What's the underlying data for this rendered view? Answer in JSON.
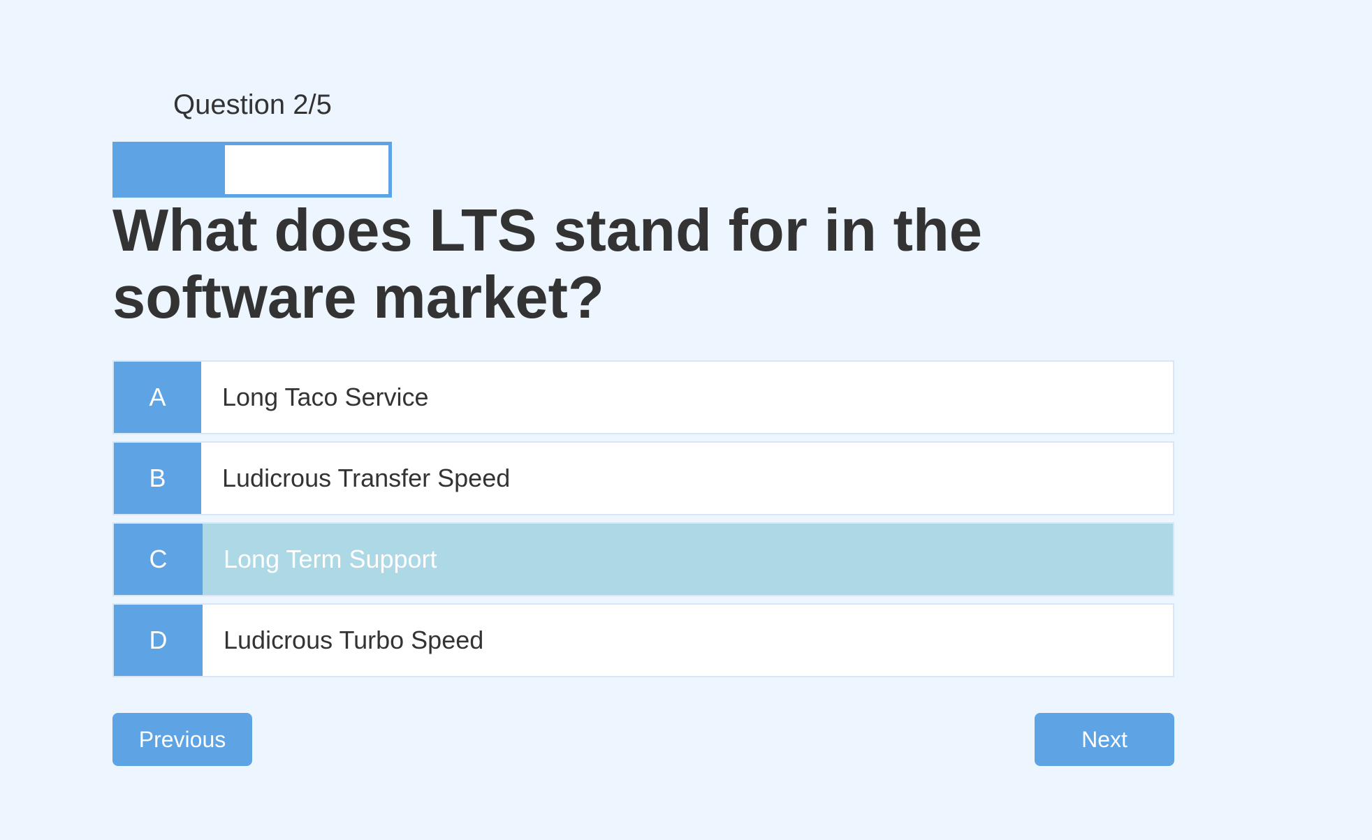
{
  "quiz": {
    "counter": "Question 2/5",
    "progress": 0.4,
    "question": "What does LTS stand for in the software market?",
    "answers": [
      {
        "letter": "A",
        "text": "Long Taco Service",
        "selected": false
      },
      {
        "letter": "B",
        "text": "Ludicrous Transfer Speed",
        "selected": false
      },
      {
        "letter": "C",
        "text": "Long Term Support",
        "selected": true
      },
      {
        "letter": "D",
        "text": "Ludicrous Turbo Speed",
        "selected": false
      }
    ],
    "previous_label": "Previous",
    "next_label": "Next"
  },
  "colors": {
    "background": "#edf5fe",
    "accent": "#5ea3e4",
    "selected": "#add8e6"
  }
}
